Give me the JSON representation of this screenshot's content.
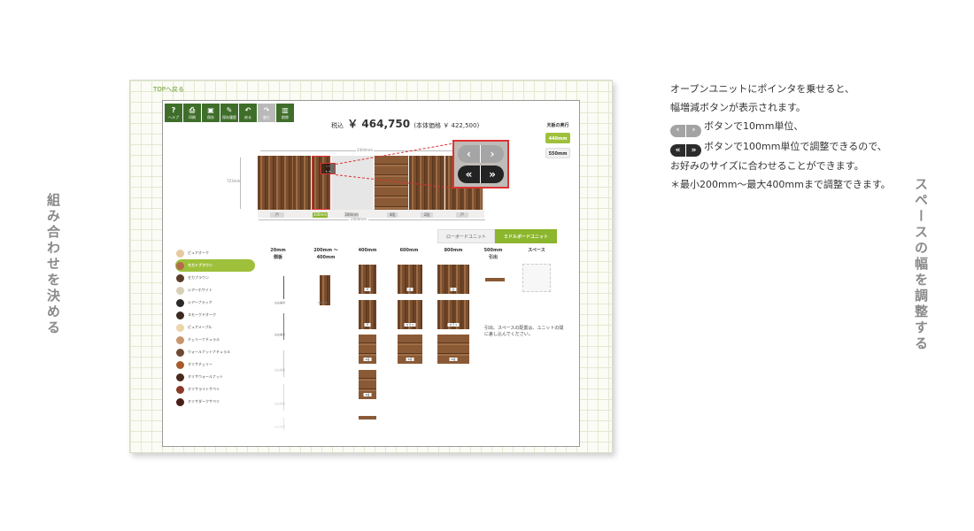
{
  "side_labels": {
    "left": "組み合わせを決める",
    "right": "スペースの幅を調整する"
  },
  "explanation": {
    "line1": "オープンユニットにポインタを乗せると、",
    "line2": "幅増減ボタンが表示されます。",
    "line3": "ボタンで10mm単位、",
    "line4": "ボタンで100mm単位で調整できるので、",
    "line5": "お好みのサイズに合わせることができます。",
    "line6": "＊最小200mm～最大400mmまで調整できます。",
    "icon_small_left": "‹",
    "icon_small_right": "›",
    "icon_big_left": "«",
    "icon_big_right": "»"
  },
  "app": {
    "top_link": "TOPへ戻る",
    "toolbar": [
      {
        "icon": "?",
        "label": "ヘルプ"
      },
      {
        "icon": "⎙",
        "label": "印刷"
      },
      {
        "icon": "▣",
        "label": "保存"
      },
      {
        "icon": "✎",
        "label": "保存履歴"
      },
      {
        "icon": "↶",
        "label": "戻る"
      },
      {
        "icon": "↷",
        "label": "進む"
      },
      {
        "icon": "▥",
        "label": "削除"
      }
    ],
    "price": {
      "prefix": "税込",
      "amount": "￥ 464,750",
      "sub": "(本体価格 ￥ 422,500)"
    },
    "depth": {
      "title": "天板の奥行",
      "options": [
        "440mm",
        "550mm"
      ]
    },
    "cabinet": {
      "width_top": "2404mm",
      "width_bottom": "2404mm",
      "height": "723mm",
      "tag_selected": "300mm",
      "tag_open": "300mm"
    },
    "tabs": [
      "ローボードユニット",
      "ミドルボードユニット"
    ],
    "colors": [
      {
        "name": "ピュアオーク",
        "hex": "#e7c9a0"
      },
      {
        "name": "モカトブラウン",
        "hex": "#b56a4e"
      },
      {
        "name": "セカブラウン",
        "hex": "#5a3a2a"
      },
      {
        "name": "シアーホワイト",
        "hex": "#d8cfb8"
      },
      {
        "name": "シアーブラック",
        "hex": "#2d2926"
      },
      {
        "name": "スモークドオーク",
        "hex": "#3a2a22"
      },
      {
        "name": "ピュアメープル",
        "hex": "#ead6a8"
      },
      {
        "name": "チェリーナチュラル",
        "hex": "#c8946a"
      },
      {
        "name": "ウォールナットナチュラル",
        "hex": "#6e4a33"
      },
      {
        "name": "オリサチェリー",
        "hex": "#a85a2c"
      },
      {
        "name": "オリサウォールナット",
        "hex": "#4a2a1e"
      },
      {
        "name": "オリサライトサペリ",
        "hex": "#8a3a26"
      },
      {
        "name": "オリサダークサペリ",
        "hex": "#4a1e18"
      }
    ],
    "catalog": {
      "col20": {
        "size": "20mm",
        "name": "側板"
      },
      "col200": {
        "size": "200mm ～",
        "size2": "400mm"
      },
      "col400": {
        "size": "400mm"
      },
      "col600": {
        "size": "600mm"
      },
      "col800": {
        "size": "800mm"
      },
      "col500": {
        "size": "500mm",
        "name": "引出"
      },
      "colspace": {
        "name": "スペース"
      },
      "label_door": "戸",
      "label_door_open": "扉",
      "label_glass": "ガラス",
      "label_drawer": "4段",
      "label_cabinet": "2段",
      "slim_labels": [
        "左右兼用",
        "左右兼用",
        "左右兼用",
        "左右兼用",
        "左右兼用"
      ],
      "open_label": "200mm",
      "note": "引出、スペースの配置は、ユニットの間に差し込んでください。"
    }
  }
}
